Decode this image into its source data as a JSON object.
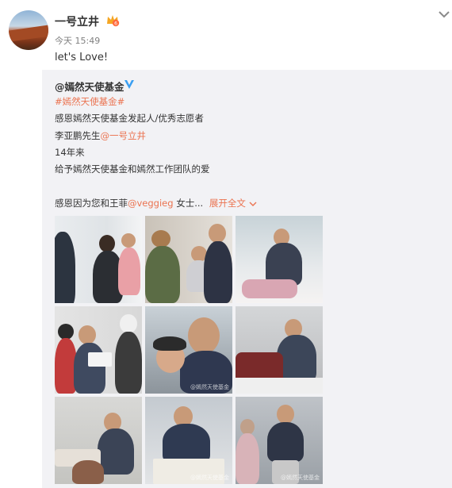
{
  "post": {
    "username": "一号立井",
    "timestamp": "今天 15:49",
    "text": "let's Love!"
  },
  "repost": {
    "author": "@嫣然天使基金",
    "hashtag": "#嫣然天使基金#",
    "line1": "感恩嫣然天使基金发起人/优秀志愿者",
    "line2_prefix": "李亚鹏先生",
    "line2_mention": "@一号立井",
    "line3": "14年来",
    "line4": "给予嫣然天使基金和嫣然工作团队的爱",
    "line5_prefix": "感恩因为您和王菲",
    "line5_mention": "@veggieg",
    "line5_suffix": " 女士...",
    "expand_label": "展开全文",
    "expand_icon": "chevron-down-icon"
  },
  "photos": {
    "count": 9,
    "watermark": "@嫣然天使基金"
  },
  "colors": {
    "accent": "#eb7350",
    "repost_bg": "#f2f2f5",
    "verified": "#3a9ff2"
  }
}
